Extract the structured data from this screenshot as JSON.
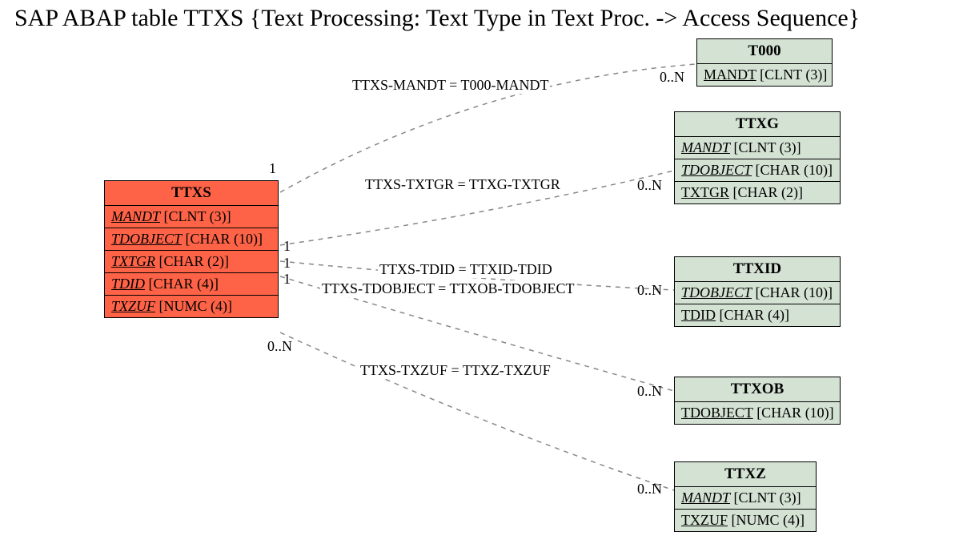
{
  "title": "SAP ABAP table TTXS {Text Processing: Text Type in Text Proc. -> Access Sequence}",
  "main_entity": {
    "name": "TTXS",
    "fields": [
      {
        "pk": true,
        "name": "MANDT",
        "type": "[CLNT (3)]"
      },
      {
        "pk": true,
        "name": "TDOBJECT",
        "type": "[CHAR (10)]"
      },
      {
        "pk": true,
        "name": "TXTGR",
        "type": "[CHAR (2)]"
      },
      {
        "pk": true,
        "name": "TDID",
        "type": "[CHAR (4)]"
      },
      {
        "pk": true,
        "name": "TXZUF",
        "type": "[NUMC (4)]"
      }
    ]
  },
  "related": [
    {
      "name": "T000",
      "fields": [
        {
          "pk": true,
          "name": "MANDT",
          "type": "[CLNT (3)]"
        }
      ],
      "rel_label": "TTXS-MANDT = T000-MANDT",
      "left_card": "1",
      "right_card": "0..N"
    },
    {
      "name": "TTXG",
      "fields": [
        {
          "pk": true,
          "name": "MANDT",
          "type": "[CLNT (3)]"
        },
        {
          "pk": true,
          "name": "TDOBJECT",
          "type": "[CHAR (10)]"
        },
        {
          "pk": false,
          "name": "TXTGR",
          "type": "[CHAR (2)]"
        }
      ],
      "rel_label": "TTXS-TXTGR = TTXG-TXTGR",
      "left_card": "1",
      "right_card": "0..N"
    },
    {
      "name": "TTXID",
      "fields": [
        {
          "pk": true,
          "name": "TDOBJECT",
          "type": "[CHAR (10)]"
        },
        {
          "pk": false,
          "name": "TDID",
          "type": "[CHAR (4)]"
        }
      ],
      "rel_label": "TTXS-TDID = TTXID-TDID",
      "left_card": "1",
      "right_card": "0..N"
    },
    {
      "name": "TTXOB",
      "fields": [
        {
          "pk": false,
          "name": "TDOBJECT",
          "type": "[CHAR (10)]"
        }
      ],
      "rel_label": "TTXS-TDOBJECT = TTXOB-TDOBJECT",
      "left_card": "1",
      "right_card": "0..N"
    },
    {
      "name": "TTXZ",
      "fields": [
        {
          "pk": true,
          "name": "MANDT",
          "type": "[CLNT (3)]"
        },
        {
          "pk": false,
          "name": "TXZUF",
          "type": "[NUMC (4)]"
        }
      ],
      "rel_label": "TTXS-TXZUF = TTXZ-TXZUF",
      "left_card": "0..N",
      "right_card": "0..N"
    }
  ]
}
